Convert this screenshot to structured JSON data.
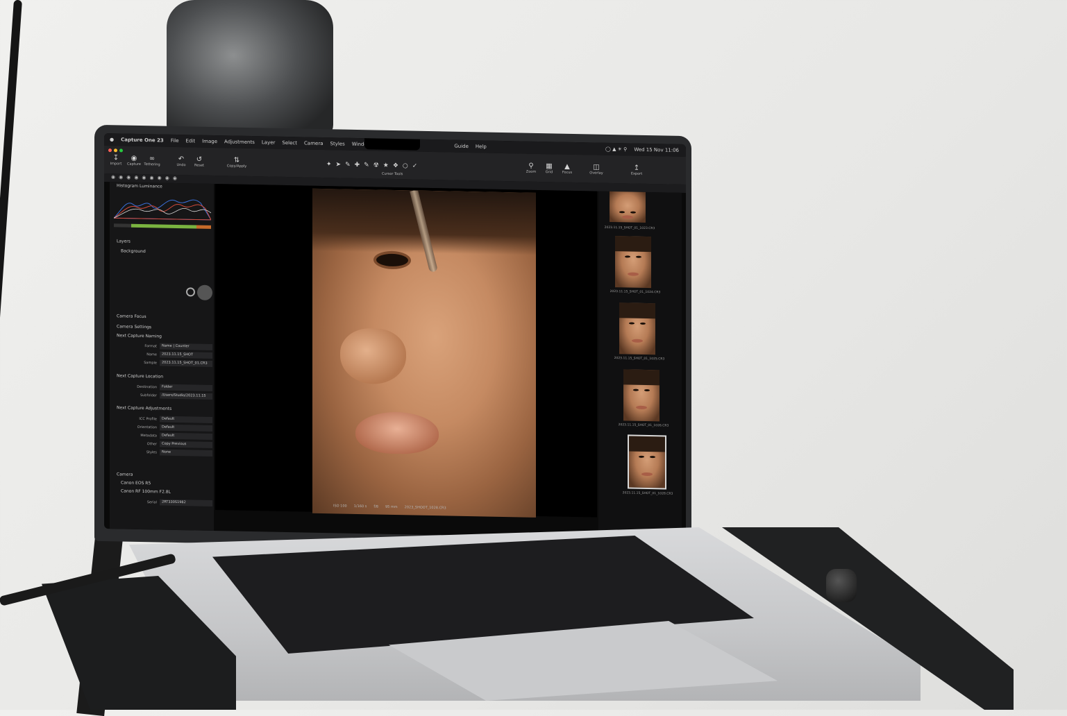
{
  "menubar": {
    "app_name": "Capture One 23",
    "menus": [
      "File",
      "Edit",
      "Image",
      "Adjustments",
      "Layer",
      "Select",
      "Camera",
      "Styles",
      "Window",
      "Guide",
      "Help"
    ],
    "clock": "Wed 15 Nov  11:06"
  },
  "toolbar": {
    "left_tools": [
      "Import",
      "Capture",
      "Tethering",
      "Undo",
      "Reset",
      "Copy/Apply"
    ],
    "center_label": "Cursor Tools",
    "right_tools": [
      "Zoom",
      "Grid",
      "Focus",
      "Overlay",
      "Export"
    ]
  },
  "panel": {
    "histogram_title": "Histogram  Luminance",
    "layers_title": "Layers",
    "layer_background": "Background",
    "camera_focus": "Camera Focus",
    "camera_settings": "Camera Settings",
    "next_capture_naming": {
      "title": "Next Capture Naming",
      "format_label": "Format",
      "format_value": "Name  |  Counter",
      "sample_label": "Name",
      "sample_value": "2023.11.15_SHOT",
      "counter_label": "Sample",
      "counter_value": "2023.11.15_SHOT_01.CR3"
    },
    "next_capture_location": {
      "title": "Next Capture Location",
      "destination_label": "Destination",
      "destination_value": "Folder",
      "subfolder_label": "Subfolder",
      "subfolder_value": "/Users/Studio/2023.11.15"
    },
    "next_capture_adjustments": {
      "title": "Next Capture Adjustments",
      "rows": [
        {
          "label": "ICC Profile",
          "value": "Default"
        },
        {
          "label": "Orientation",
          "value": "Default"
        },
        {
          "label": "Metadata",
          "value": "Default"
        },
        {
          "label": "Other",
          "value": "Copy Previous"
        },
        {
          "label": "Styles",
          "value": "None"
        }
      ]
    },
    "camera_title": "Camera",
    "camera_model": "Canon EOS R5",
    "lens": "Canon RF 100mm F2.8L",
    "serial_label": "Serial",
    "serial_value": "2RT330S1982"
  },
  "viewer": {
    "status": [
      "ISO 100",
      "1/160 s",
      "f/8",
      "95 mm",
      "2023_SHOOT_1028.CR3"
    ]
  },
  "filmstrip": {
    "captions": [
      "2023.11.15_SHOT_01_1023.CR3",
      "2023.11.15_SHOT_01_1024.CR3",
      "2023.11.15_SHOT_01_1025.CR3",
      "2023.11.15_SHOT_01_1026.CR3",
      "2023.11.15_SHOT_01_1028.CR3"
    ]
  }
}
